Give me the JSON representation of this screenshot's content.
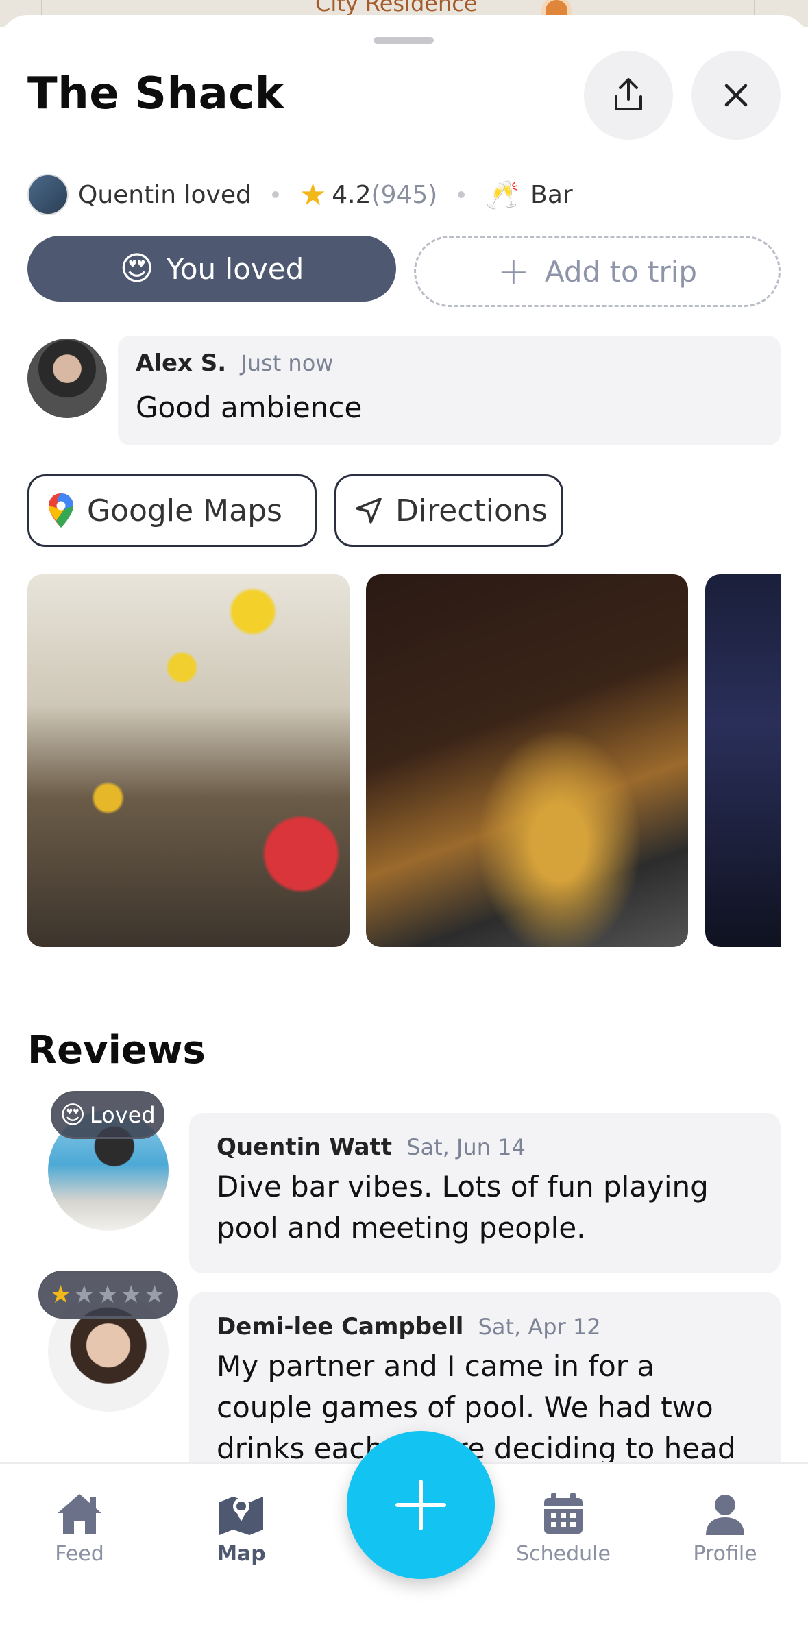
{
  "map": {
    "label": "City Residence"
  },
  "place": {
    "title": "The Shack",
    "loved_by": "Quentin loved",
    "rating": "4.2",
    "rating_count": "(945)",
    "category_icon": "🥂",
    "category": "Bar"
  },
  "actions": {
    "loved_emoji": "😍",
    "loved_label": "You loved",
    "add_trip_icon": "+",
    "add_trip_label": "Add to trip",
    "google_maps_label": "Google Maps",
    "directions_label": "Directions"
  },
  "comment": {
    "author": "Alex S.",
    "time": "Just now",
    "text": "Good ambience"
  },
  "reviews": {
    "title": "Reviews",
    "items": [
      {
        "badge_emoji": "😍",
        "badge_label": "Loved",
        "author": "Quentin Watt",
        "date": "Sat, Jun 14",
        "text": "Dive bar vibes. Lots of fun playing pool and meeting people."
      },
      {
        "stars_filled": "★",
        "stars_empty": "★★★★",
        "stars": 1,
        "author": "Demi-lee Campbell",
        "date": "Sat, Apr 12",
        "text": "My partner and I came in for a couple games of pool. We had two drinks each before deciding to head"
      }
    ]
  },
  "tabbar": {
    "feed": "Feed",
    "map": "Map",
    "schedule": "Schedule",
    "profile": "Profile",
    "active": "Map"
  },
  "colors": {
    "primary_dark": "#4e5870",
    "fab": "#13c3f2",
    "star": "#f2b81a"
  }
}
